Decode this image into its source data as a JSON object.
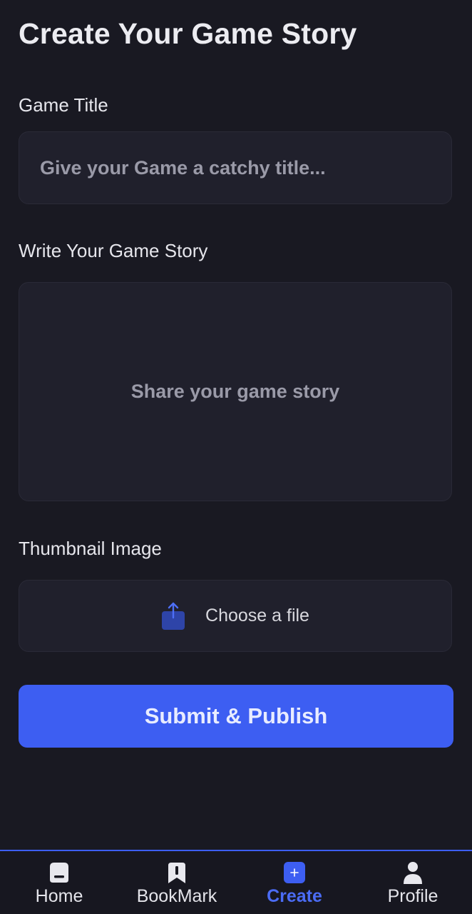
{
  "page": {
    "title": "Create Your Game Story"
  },
  "form": {
    "title_label": "Game Title",
    "title_placeholder": "Give your Game a catchy title...",
    "title_value": "",
    "story_label": "Write Your Game Story",
    "story_placeholder": "Share your game story",
    "story_value": "",
    "thumbnail_label": "Thumbnail Image",
    "thumbnail_button": "Choose a file",
    "submit_label": "Submit & Publish"
  },
  "bottom_nav": {
    "items": [
      {
        "label": "Home",
        "icon": "home-icon",
        "active": false
      },
      {
        "label": "BookMark",
        "icon": "bookmark-icon",
        "active": false
      },
      {
        "label": "Create",
        "icon": "plus-square-icon",
        "active": true
      },
      {
        "label": "Profile",
        "icon": "person-icon",
        "active": false
      }
    ]
  },
  "colors": {
    "background": "#191922",
    "field_background": "#20202c",
    "accent": "#3d5ef2",
    "active_nav": "#4b6cf5",
    "placeholder": "#9a9aa8"
  }
}
